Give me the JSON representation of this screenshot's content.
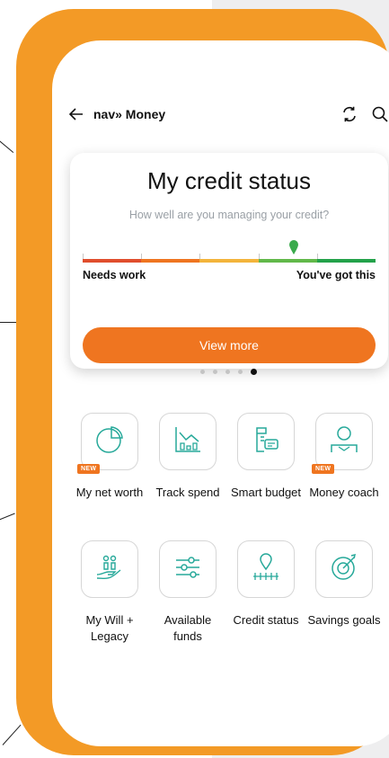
{
  "theme": {
    "accent": "#ef7520",
    "frame": "#f39a26",
    "teal": "#27a99a"
  },
  "header": {
    "title": "nav» Money",
    "back_icon": "back-arrow-icon",
    "refresh_icon": "refresh-icon",
    "search_icon": "search-icon"
  },
  "credit_card": {
    "title": "My credit status",
    "subtitle": "How well are you managing your credit?",
    "gauge": {
      "segments": [
        "#e04e2d",
        "#ef7520",
        "#f3b43b",
        "#62b94a",
        "#23a24a"
      ],
      "marker_position": 0.72,
      "left_label": "Needs work",
      "right_label": "You've got this"
    },
    "button_label": "View more"
  },
  "carousel": {
    "total": 5,
    "active_index": 4
  },
  "tiles": [
    {
      "label": "My net worth",
      "icon": "pie-chart-icon",
      "badge": "NEW"
    },
    {
      "label": "Track spend",
      "icon": "chart-trend-icon",
      "badge": ""
    },
    {
      "label": "Smart budget",
      "icon": "budget-document-icon",
      "badge": ""
    },
    {
      "label": "Money coach",
      "icon": "coach-person-icon",
      "badge": "NEW"
    },
    {
      "label": "My Will + Legacy",
      "icon": "family-hand-icon",
      "badge": ""
    },
    {
      "label": "Available funds",
      "icon": "sliders-icon",
      "badge": ""
    },
    {
      "label": "Credit status",
      "icon": "credit-gauge-icon",
      "badge": ""
    },
    {
      "label": "Savings goals",
      "icon": "target-goal-icon",
      "badge": ""
    }
  ]
}
